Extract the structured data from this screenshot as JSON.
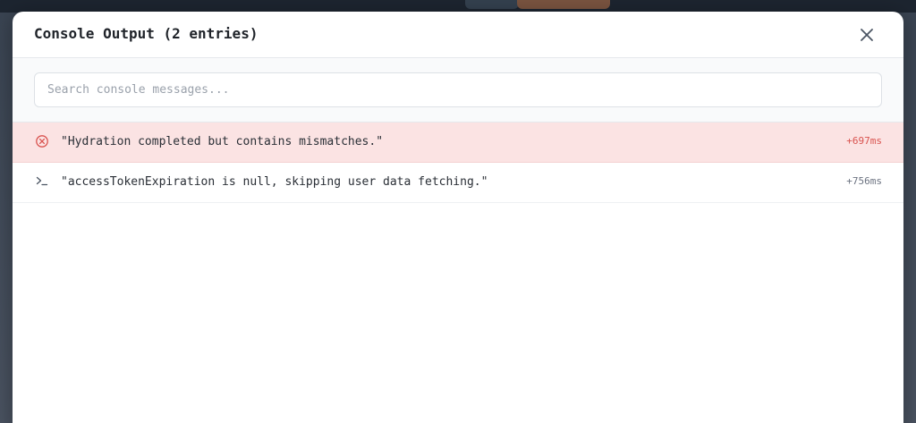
{
  "modal": {
    "title": "Console Output (2 entries)",
    "close_icon": "close-icon"
  },
  "search": {
    "placeholder": "Search console messages..."
  },
  "entries": [
    {
      "level": "error",
      "icon": "error-circle-icon",
      "message": "\"Hydration completed but contains mismatches.\"",
      "time": "+697ms"
    },
    {
      "level": "log",
      "icon": "terminal-prompt-icon",
      "message": "\"accessTokenExpiration is null, skipping user data fetching.\"",
      "time": "+756ms"
    }
  ],
  "colors": {
    "error_background": "#fbe3e3",
    "error_accent": "#d9534f",
    "text": "#2a2f36",
    "muted": "#6b7280"
  }
}
